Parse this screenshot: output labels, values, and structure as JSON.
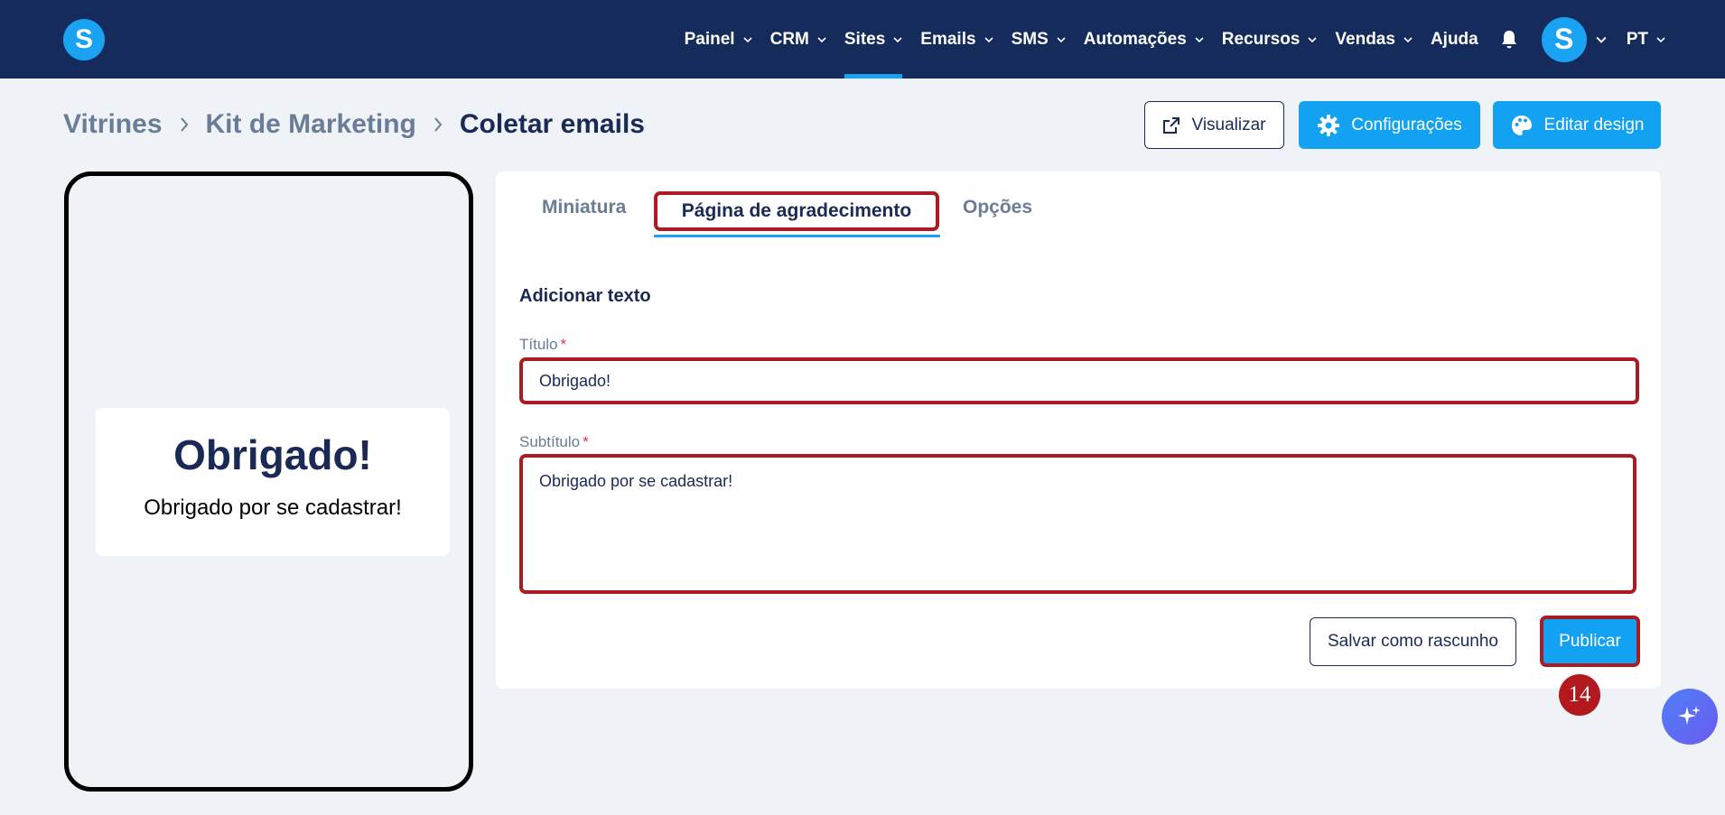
{
  "colors": {
    "nav_bg": "#142b5c",
    "accent": "#13a1f2",
    "highlight": "#a91c24",
    "text": "#1b2a55",
    "muted": "#6b7c97"
  },
  "nav": {
    "logo_letter": "S",
    "items": [
      {
        "label": "Painel",
        "dropdown": true
      },
      {
        "label": "CRM",
        "dropdown": true
      },
      {
        "label": "Sites",
        "dropdown": true,
        "active": true
      },
      {
        "label": "Emails",
        "dropdown": true
      },
      {
        "label": "SMS",
        "dropdown": true
      },
      {
        "label": "Automações",
        "dropdown": true
      },
      {
        "label": "Recursos",
        "dropdown": true
      },
      {
        "label": "Vendas",
        "dropdown": true
      },
      {
        "label": "Ajuda",
        "dropdown": false
      }
    ],
    "notifications_icon": "bell-icon",
    "avatar_letter": "S",
    "language": "PT"
  },
  "breadcrumb": {
    "items": [
      "Vitrines",
      "Kit de Marketing",
      "Coletar emails"
    ]
  },
  "header_buttons": {
    "preview_label": "Visualizar",
    "settings_label": "Configurações",
    "edit_design_label": "Editar design"
  },
  "preview": {
    "title": "Obrigado!",
    "subtitle": "Obrigado por se cadastrar!"
  },
  "tabs": {
    "items": [
      "Miniatura",
      "Página de agradecimento",
      "Opções"
    ],
    "active_index": 1
  },
  "form": {
    "section_title": "Adicionar texto",
    "title_label": "Título",
    "title_value": "Obrigado!",
    "subtitle_label": "Subtítulo",
    "subtitle_value": "Obrigado por se cadastrar!",
    "required_mark": "*",
    "draft_label": "Salvar como rascunho",
    "publish_label": "Publicar"
  },
  "step_badge": "14",
  "ai_button_icon": "sparkles-icon"
}
